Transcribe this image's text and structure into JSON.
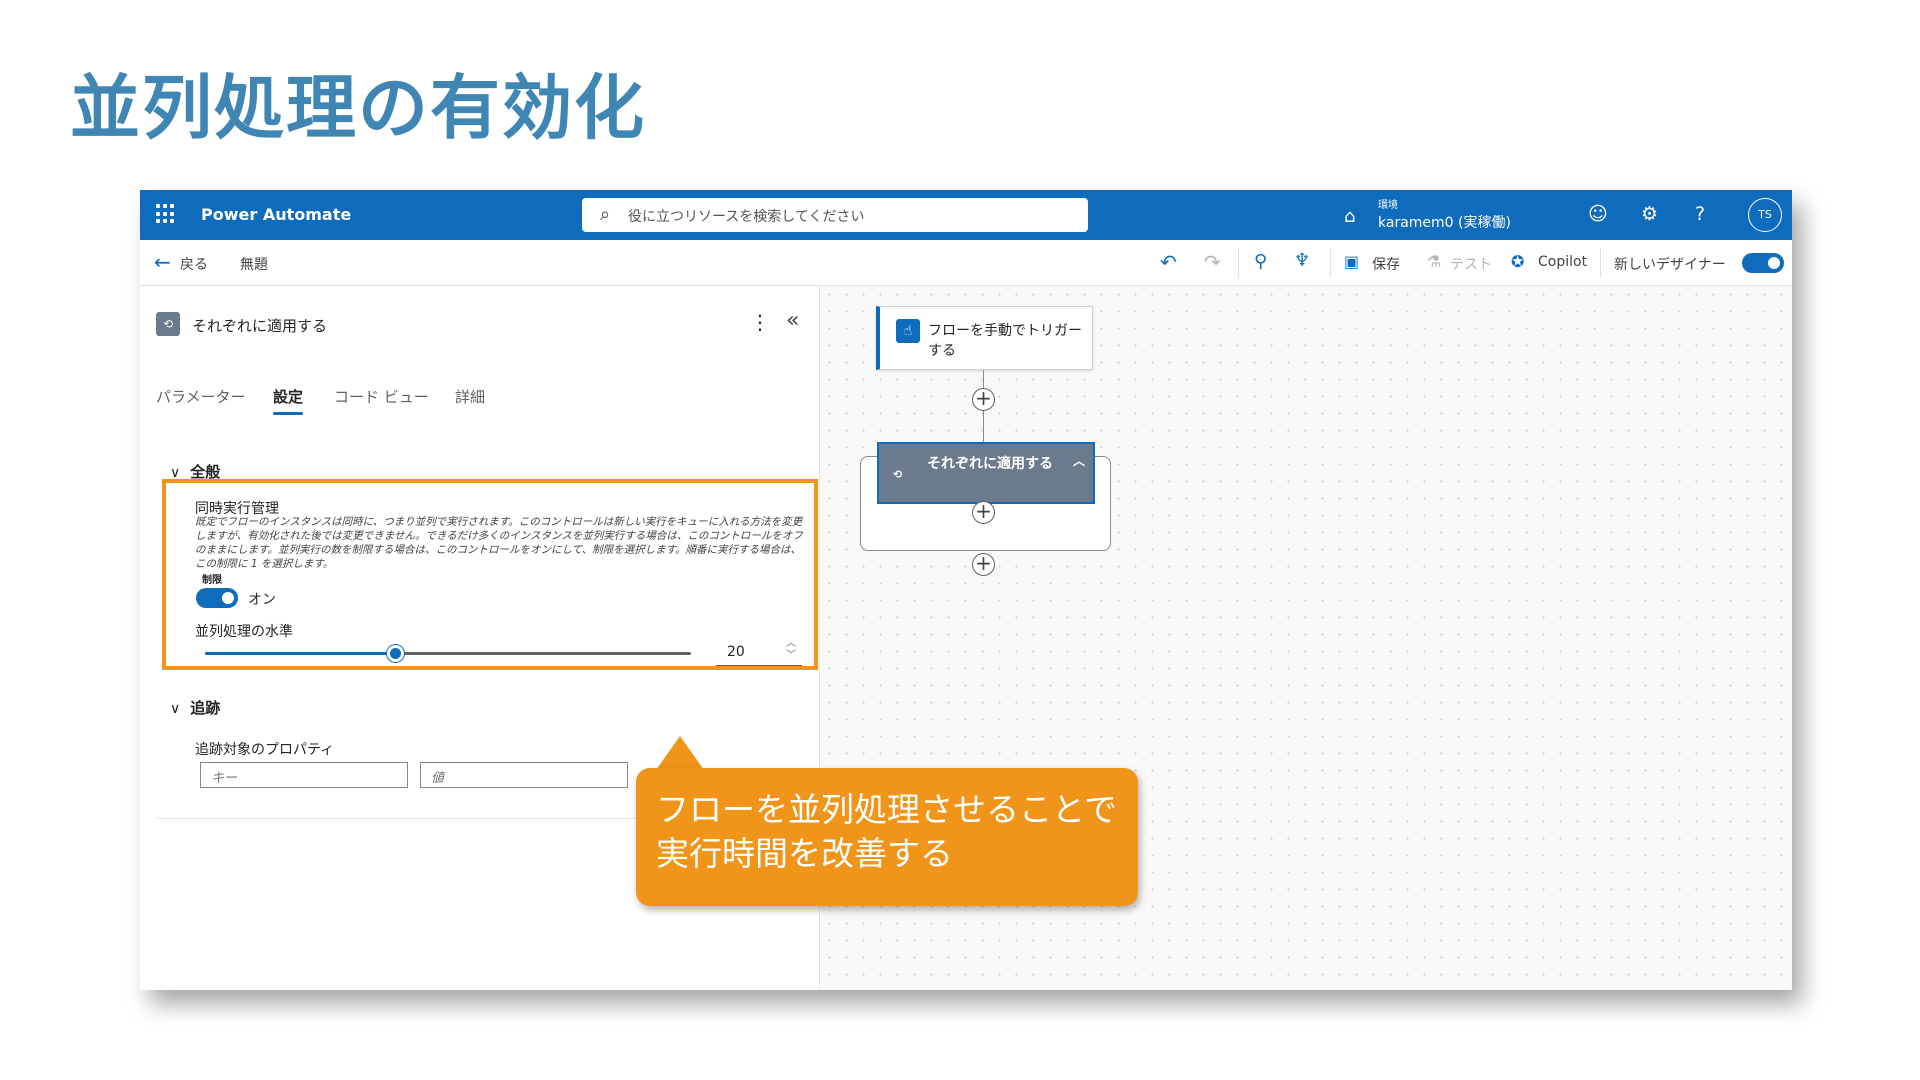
{
  "slide": {
    "title": "並列処理の有効化",
    "callout": "フローを並列処理させることで実行時間を改善する"
  },
  "topbar": {
    "app_name": "Power Automate",
    "search_placeholder": "役に立つリソースを検索してください",
    "env_label": "環境",
    "env_value": "karamem0 (実稼働)",
    "avatar": "TS",
    "icons": [
      "waffle-icon",
      "search-icon",
      "environment-icon",
      "feedback-icon",
      "settings-icon",
      "help-icon"
    ]
  },
  "cmdbar": {
    "back": "戻る",
    "flow_name": "無題",
    "save": "保存",
    "test": "テスト",
    "copilot": "Copilot",
    "new_designer": "新しいデザイナー",
    "new_designer_on": true
  },
  "panel": {
    "title": "それぞれに適用する",
    "tabs": [
      "パラメーター",
      "設定",
      "コード ビュー",
      "詳細"
    ],
    "active_tab": "設定",
    "general": {
      "heading": "全般",
      "concurrency_label": "同時実行管理",
      "description": "既定でフローのインスタンスは同時に、つまり並列で実行されます。このコントロールは新しい実行をキューに入れる方法を変更しますが、有効化された後では変更できません。できるだけ多くのインスタンスを並列実行する場合は、このコントロールをオフのままにします。並列実行の数を制限する場合は、このコントロールをオンにして、制限を選択します。順番に実行する場合は、この制限に 1 を選択します。",
      "limit_label": "制限",
      "limit_state": "オン",
      "parallelism_label": "並列処理の水準",
      "parallelism_value": "20",
      "slider_fraction": 0.39
    },
    "tracking": {
      "heading": "追跡",
      "properties_label": "追跡対象のプロパティ",
      "key_placeholder": "キー",
      "value_placeholder": "値"
    }
  },
  "canvas": {
    "trigger": "フローを手動でトリガーする",
    "loop": "それぞれに適用する"
  }
}
